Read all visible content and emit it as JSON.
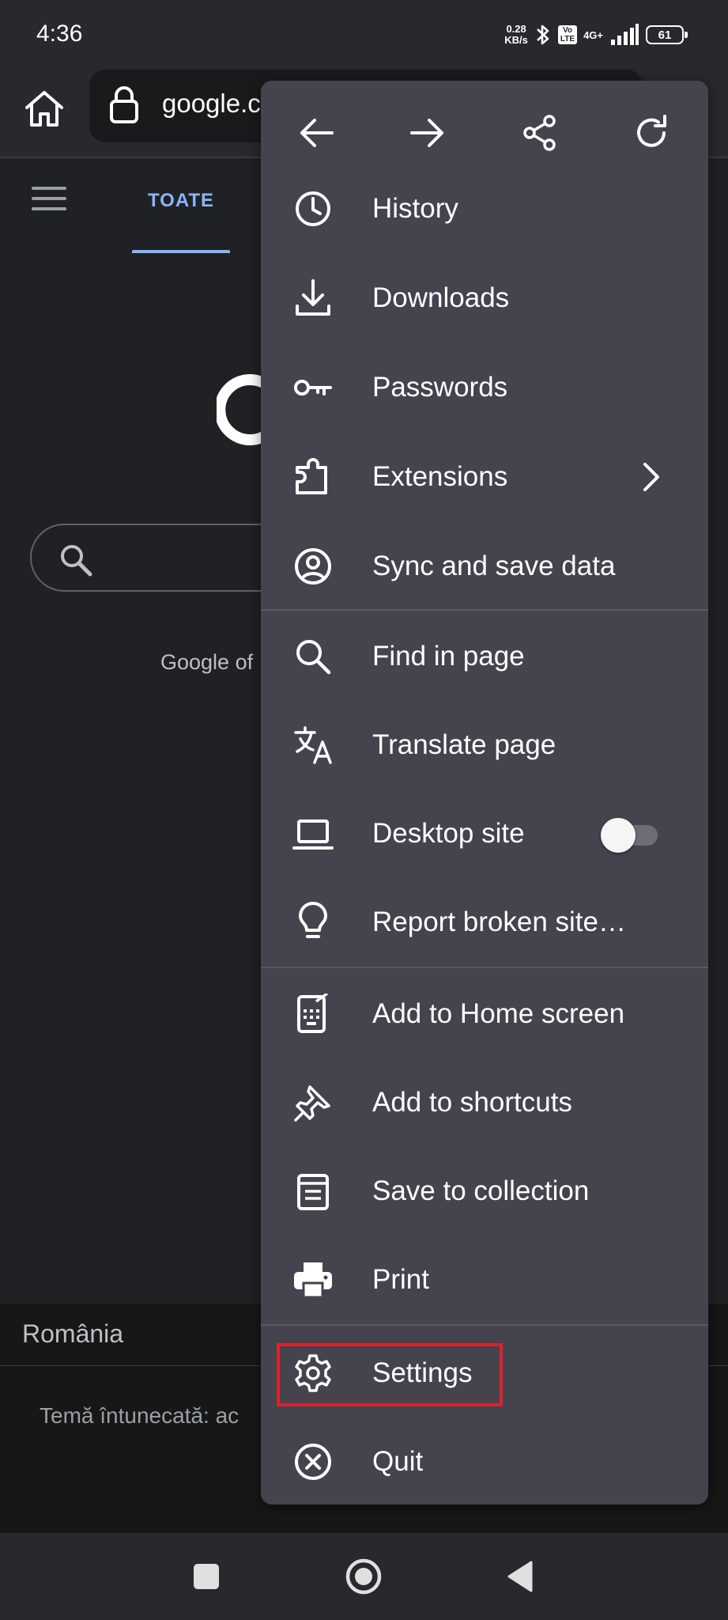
{
  "status_bar": {
    "time": "4:36",
    "net_speed_value": "0.28",
    "net_speed_unit": "KB/s",
    "volte_top": "Vo",
    "volte_bottom": "LTE",
    "network": "4G+",
    "battery": "61"
  },
  "toolbar": {
    "url": "google.c"
  },
  "page": {
    "tab_all": "TOATE",
    "offered_text": "Google of",
    "region": "România",
    "theme_text": "Temă întunecată: ac"
  },
  "menu": {
    "history": "History",
    "downloads": "Downloads",
    "passwords": "Passwords",
    "extensions": "Extensions",
    "sync": "Sync and save data",
    "find": "Find in page",
    "translate": "Translate page",
    "desktop_site": "Desktop site",
    "desktop_site_enabled": false,
    "report": "Report broken site…",
    "add_home": "Add to Home screen",
    "add_shortcuts": "Add to shortcuts",
    "save_collection": "Save to collection",
    "print": "Print",
    "settings": "Settings",
    "quit": "Quit"
  },
  "colors": {
    "menu_bg": "#44434e",
    "accent_blue": "#8ab4f8",
    "highlight_red": "#e0202b"
  }
}
